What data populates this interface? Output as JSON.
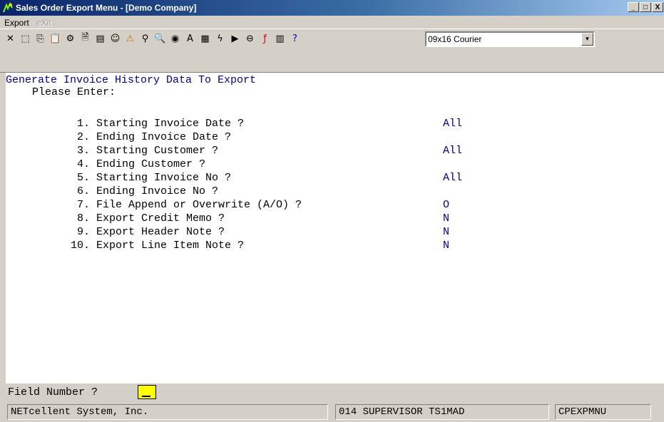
{
  "window": {
    "title": "Sales Order Export Menu - [Demo Company]",
    "controls": [
      "_",
      "□",
      "X"
    ]
  },
  "menu": [
    {
      "label": "Export",
      "disabled": false
    },
    {
      "label": "eXit",
      "disabled": true
    }
  ],
  "toolbar": {
    "icons": [
      "cancel-icon",
      "select-icon",
      "copy-icon",
      "paste-icon",
      "settings-icon",
      "properties-icon",
      "notes-icon",
      "user-card-icon",
      "warning-icon",
      "find-icon",
      "zoom-icon",
      "globe-icon",
      "font-icon",
      "calculator-icon",
      "lightning-icon",
      "run-icon",
      "link-icon",
      "function-icon",
      "document-icon",
      "help-pointer-icon"
    ],
    "font_value": "09x16 Courier"
  },
  "screen": {
    "heading": "Generate Invoice History Data To Export",
    "prompt": "Please Enter:",
    "fields": [
      {
        "label": " 1. Starting Invoice Date ?",
        "value": "All"
      },
      {
        "label": " 2. Ending Invoice Date ?",
        "value": ""
      },
      {
        "label": " 3. Starting Customer ?",
        "value": "All"
      },
      {
        "label": " 4. Ending Customer ?",
        "value": ""
      },
      {
        "label": " 5. Starting Invoice No ?",
        "value": "All"
      },
      {
        "label": " 6. Ending Invoice No ?",
        "value": ""
      },
      {
        "label": " 7. File Append or Overwrite (A/O) ?",
        "value": "O"
      },
      {
        "label": " 8. Export Credit Memo ?",
        "value": "N"
      },
      {
        "label": " 9. Export Header Note ?",
        "value": "N"
      },
      {
        "label": "10. Export Line Item Note ?",
        "value": "N"
      }
    ],
    "field_number_label": "Field Number ?",
    "field_number_value": ""
  },
  "status": {
    "company": "NETcellent System, Inc.",
    "user": "014 SUPERVISOR TS1MAD",
    "program": "CPEXPMNU"
  }
}
